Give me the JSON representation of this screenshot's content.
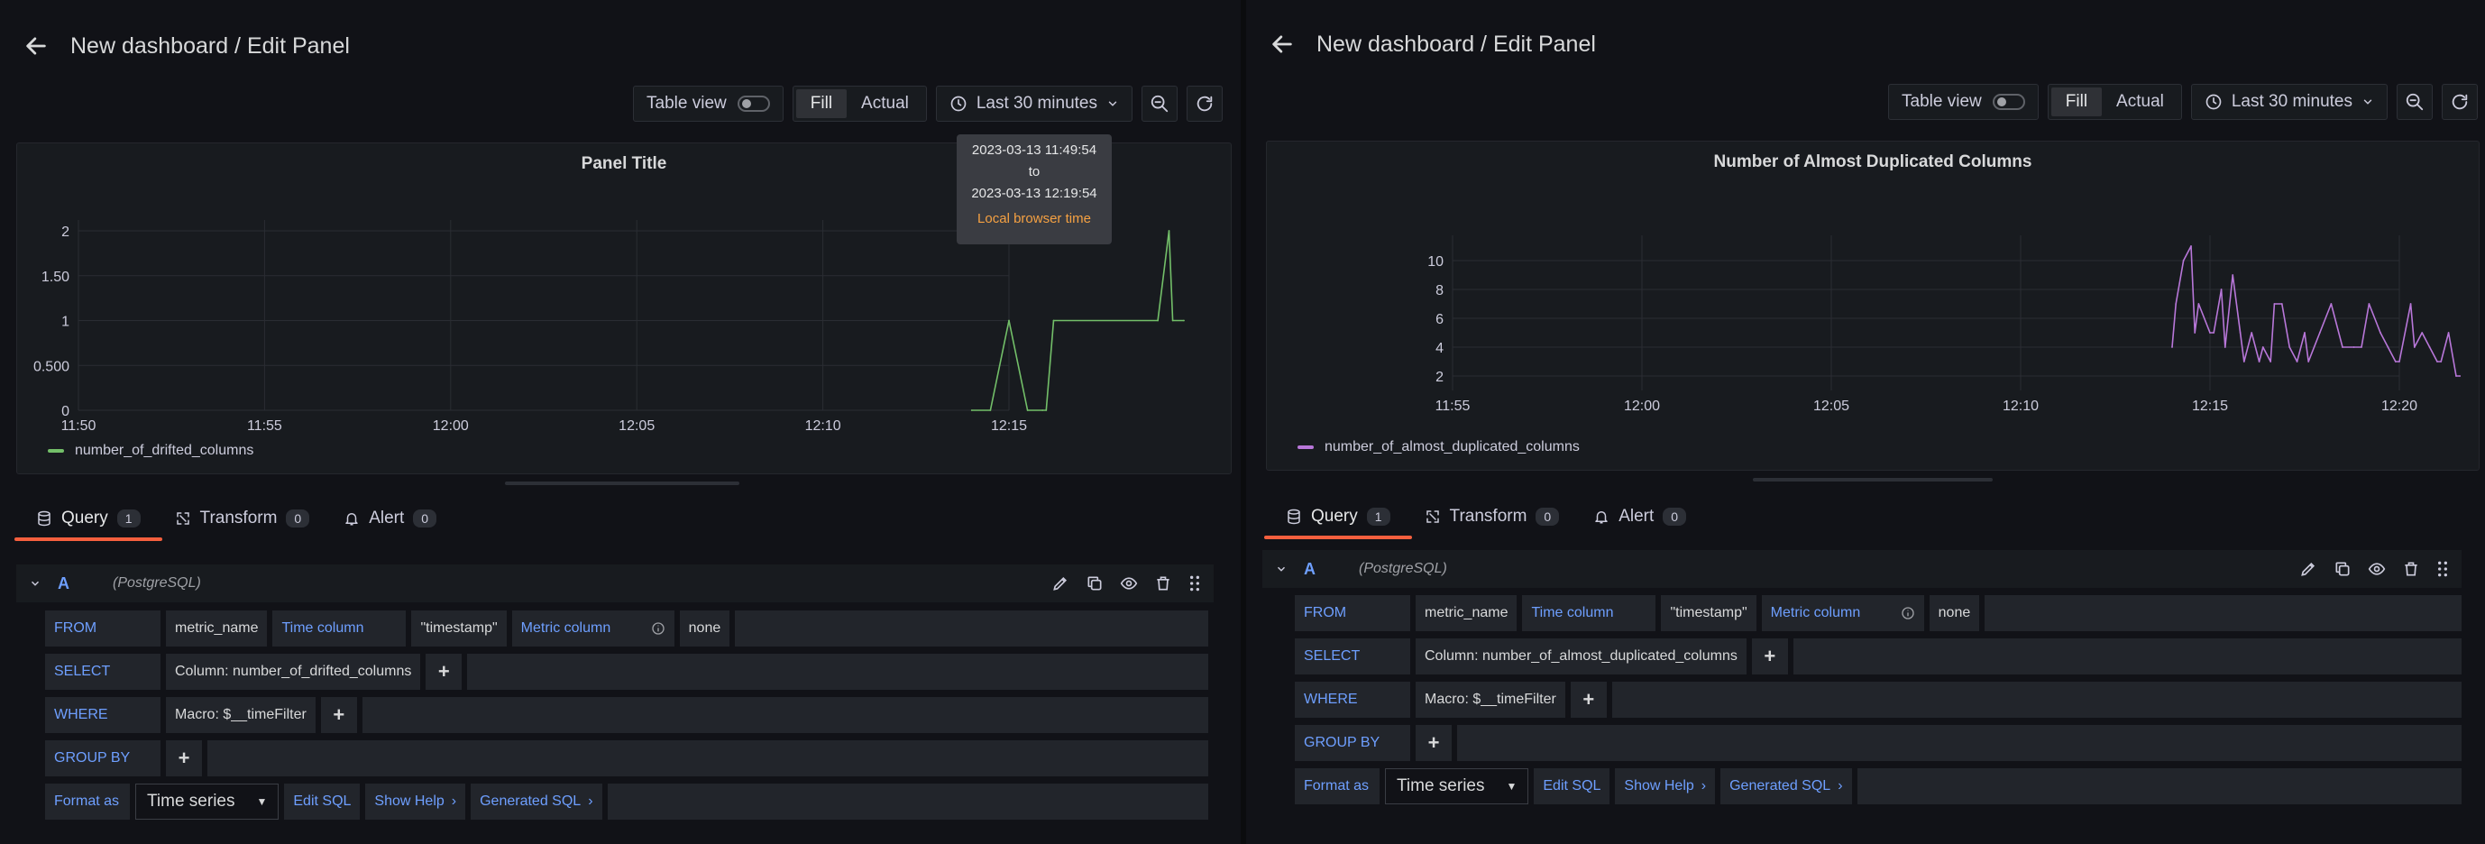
{
  "left": {
    "header": {
      "title": "New dashboard / Edit Panel"
    },
    "toolbar": {
      "table_view_label": "Table view",
      "fill_label": "Fill",
      "actual_label": "Actual",
      "time_range": "Last 30 minutes"
    },
    "tooltip": {
      "from": "2023-03-13 11:49:54",
      "to_label": "to",
      "to": "2023-03-13 12:19:54",
      "zone": "Local browser time"
    },
    "panel": {
      "title": "Panel Title",
      "legend": "number_of_drifted_columns"
    },
    "tabs": [
      {
        "label": "Query",
        "count": "1"
      },
      {
        "label": "Transform",
        "count": "0"
      },
      {
        "label": "Alert",
        "count": "0"
      }
    ],
    "query": {
      "letter": "A",
      "datasource": "(PostgreSQL)",
      "from_kw": "FROM",
      "table": "metric_name",
      "time_column_label": "Time column",
      "time_column": "\"timestamp\"",
      "metric_column_label": "Metric column",
      "metric_column": "none",
      "select_kw": "SELECT",
      "select_value": "Column: number_of_drifted_columns",
      "where_kw": "WHERE",
      "where_value": "Macro: $__timeFilter",
      "groupby_kw": "GROUP BY",
      "format_kw": "Format as",
      "format_value": "Time series",
      "edit_sql": "Edit SQL",
      "show_help": "Show Help",
      "generated_sql": "Generated SQL"
    }
  },
  "right": {
    "header": {
      "title": "New dashboard / Edit Panel"
    },
    "toolbar": {
      "table_view_label": "Table view",
      "fill_label": "Fill",
      "actual_label": "Actual",
      "time_range": "Last 30 minutes"
    },
    "panel": {
      "title": "Number of Almost Duplicated Columns",
      "legend": "number_of_almost_duplicated_columns"
    },
    "tabs": [
      {
        "label": "Query",
        "count": "1"
      },
      {
        "label": "Transform",
        "count": "0"
      },
      {
        "label": "Alert",
        "count": "0"
      }
    ],
    "query": {
      "letter": "A",
      "datasource": "(PostgreSQL)",
      "from_kw": "FROM",
      "table": "metric_name",
      "time_column_label": "Time column",
      "time_column": "\"timestamp\"",
      "metric_column_label": "Metric column",
      "metric_column": "none",
      "select_kw": "SELECT",
      "select_value": "Column: number_of_almost_duplicated_columns",
      "where_kw": "WHERE",
      "where_value": "Macro: $__timeFilter",
      "groupby_kw": "GROUP BY",
      "format_kw": "Format as",
      "format_value": "Time series",
      "edit_sql": "Edit SQL",
      "show_help": "Show Help",
      "generated_sql": "Generated SQL"
    }
  },
  "colors": {
    "accent": "#f55f3e",
    "series_left": "#73bf69",
    "series_right": "#b877d9",
    "keyword": "#6e9fff",
    "tooltip_zone": "#f5a142"
  },
  "icons": [
    "arrow-left-icon",
    "clock-icon",
    "chevron-down-icon",
    "zoom-out-icon",
    "refresh-icon",
    "database-icon",
    "transform-icon",
    "bell-icon",
    "pencil-icon",
    "copy-icon",
    "eye-icon",
    "trash-icon",
    "drag-icon",
    "info-icon",
    "plus-icon"
  ],
  "chart_data": [
    {
      "type": "line",
      "title": "Panel Title",
      "x_ticks": [
        "11:50",
        "11:55",
        "12:00",
        "12:05",
        "12:10",
        "12:15"
      ],
      "y_ticks": [
        "0",
        "0.500",
        "1",
        "1.50",
        "2"
      ],
      "ylim": [
        0,
        2
      ],
      "grid": true,
      "legend_position": "bottom-left",
      "series": [
        {
          "name": "number_of_drifted_columns",
          "x": [
            "12:14",
            "12:14.5",
            "12:15",
            "12:15.5",
            "12:15.9",
            "12:16",
            "12:16.2",
            "12:19",
            "12:19.3",
            "12:19.4",
            "12:19.7"
          ],
          "values": [
            0,
            0,
            1,
            0,
            0,
            0,
            1,
            1,
            2,
            1,
            1
          ]
        }
      ]
    },
    {
      "type": "line",
      "title": "Number of Almost Duplicated Columns",
      "x_ticks": [
        "11:55",
        "12:00",
        "12:05",
        "12:10",
        "12:15",
        "12:20"
      ],
      "y_ticks": [
        "2",
        "4",
        "6",
        "8",
        "10"
      ],
      "ylim": [
        1,
        11
      ],
      "grid": true,
      "legend_position": "bottom-left",
      "series": [
        {
          "name": "number_of_almost_duplicated_columns",
          "x": [
            "12:14",
            "12:14.1",
            "12:14.3",
            "12:14.5",
            "12:14.6",
            "12:14.7",
            "12:15",
            "12:15.1",
            "12:15.3",
            "12:15.4",
            "12:15.6",
            "12:15.8",
            "12:15.9",
            "12:16.1",
            "12:16.3",
            "12:16.4",
            "12:16.6",
            "12:16.7",
            "12:16.9",
            "12:17.1",
            "12:17.3",
            "12:17.5",
            "12:17.6",
            "12:17.9",
            "12:18.2",
            "12:18.5",
            "12:18.8",
            "12:19",
            "12:19.2",
            "12:19.5",
            "12:19.7",
            "12:19.9",
            "12:20",
            "12:20.3",
            "12:20.4",
            "12:20.6",
            "12:20.8",
            "12:21",
            "12:21.1",
            "12:21.3",
            "12:21.5",
            "12:21.6"
          ],
          "values": [
            4,
            7,
            10,
            11,
            5,
            7,
            5,
            5,
            8,
            4,
            9,
            5,
            3,
            5,
            3,
            4,
            3,
            7,
            7,
            4,
            3,
            5,
            3,
            5,
            7,
            4,
            4,
            4,
            7,
            5,
            4,
            3,
            3,
            7,
            4,
            5,
            4,
            3,
            3,
            5,
            2,
            2
          ]
        }
      ]
    }
  ]
}
